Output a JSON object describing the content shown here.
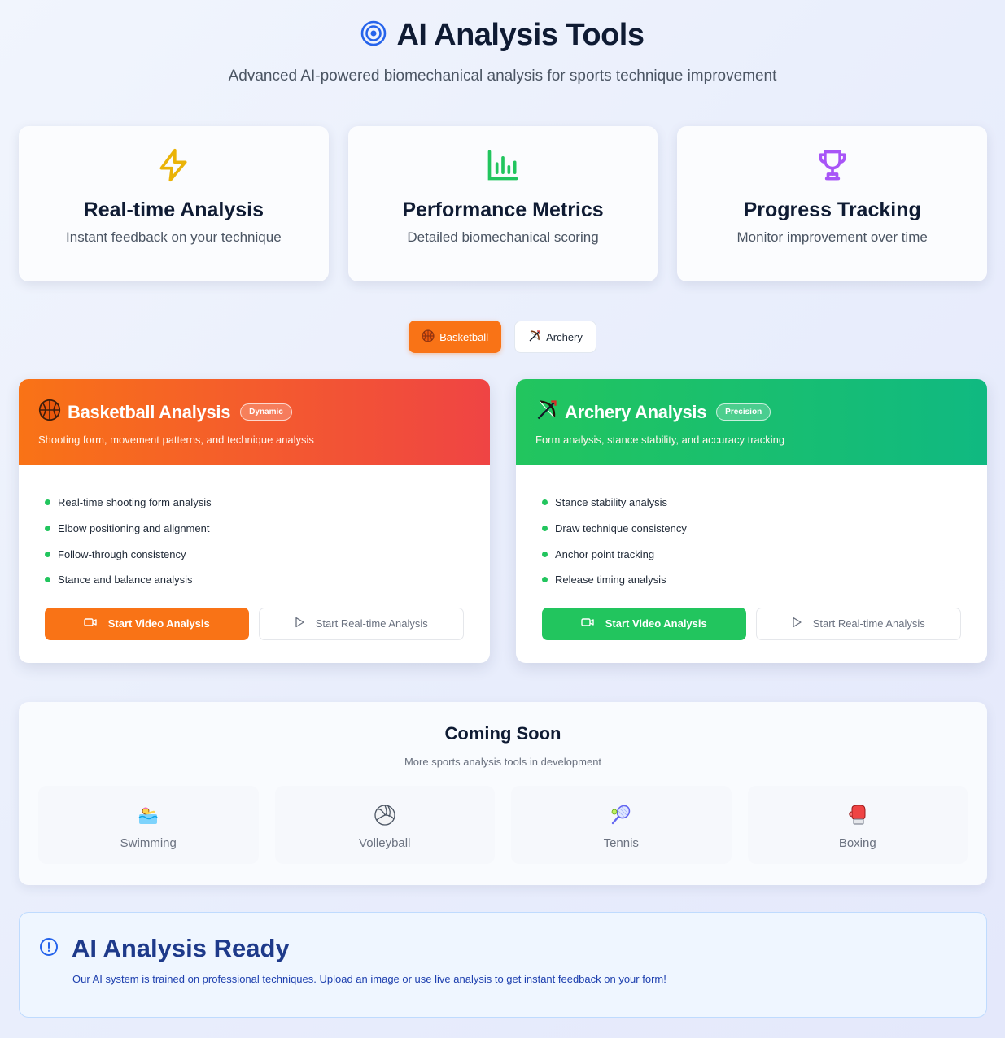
{
  "header": {
    "title": "AI Analysis Tools",
    "subtitle": "Advanced AI-powered biomechanical analysis for sports technique improvement",
    "icon": "target-icon"
  },
  "features": [
    {
      "icon": "lightning-icon",
      "title": "Real-time Analysis",
      "desc": "Instant feedback on your technique",
      "color": "#eab308"
    },
    {
      "icon": "bar-chart-icon",
      "title": "Performance Metrics",
      "desc": "Detailed biomechanical scoring",
      "color": "#22c55e"
    },
    {
      "icon": "trophy-icon",
      "title": "Progress Tracking",
      "desc": "Monitor improvement over time",
      "color": "#a855f7"
    }
  ],
  "tabs": [
    {
      "label": "Basketball",
      "icon": "basketball-icon",
      "active": true
    },
    {
      "label": "Archery",
      "icon": "bow-arrow-icon",
      "active": false
    }
  ],
  "cards": [
    {
      "title": "Basketball Analysis",
      "badge": "Dynamic",
      "desc": "Shooting form, movement patterns, and technique analysis",
      "items": [
        "Real-time shooting form analysis",
        "Elbow positioning and alignment",
        "Follow-through consistency",
        "Stance and balance analysis"
      ],
      "primary": "Start Video Analysis",
      "secondary": "Start Real-time Analysis",
      "accent": "#f97316"
    },
    {
      "title": "Archery Analysis",
      "badge": "Precision",
      "desc": "Form analysis, stance stability, and accuracy tracking",
      "items": [
        "Stance stability analysis",
        "Draw technique consistency",
        "Anchor point tracking",
        "Release timing analysis"
      ],
      "primary": "Start Video Analysis",
      "secondary": "Start Real-time Analysis",
      "accent": "#22c55e"
    }
  ],
  "coming_soon": {
    "title": "Coming Soon",
    "subtitle": "More sports analysis tools in development",
    "sports": [
      {
        "label": "Swimming",
        "icon": "swimmer-icon"
      },
      {
        "label": "Volleyball",
        "icon": "volleyball-icon"
      },
      {
        "label": "Tennis",
        "icon": "tennis-icon"
      },
      {
        "label": "Boxing",
        "icon": "boxing-glove-icon"
      }
    ]
  },
  "ready": {
    "title": "AI Analysis Ready",
    "text": "Our AI system is trained on professional techniques. Upload an image or use live analysis to get instant feedback on your form!",
    "icon": "info-icon"
  }
}
